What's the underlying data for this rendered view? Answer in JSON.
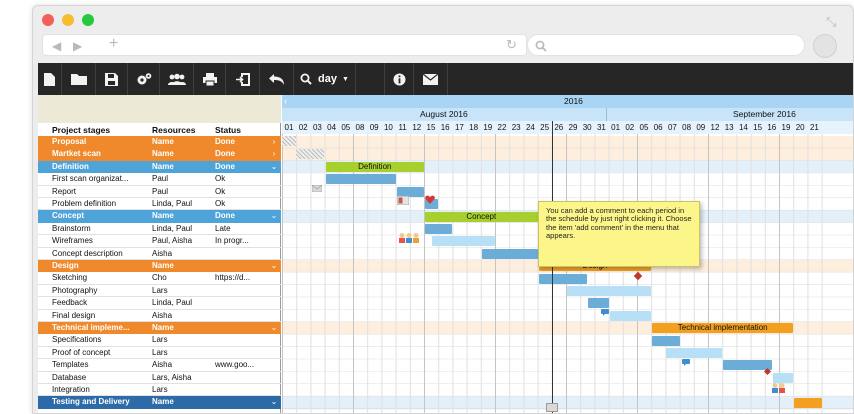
{
  "toolbar": {
    "zoom_label": "day"
  },
  "timeline": {
    "year": "2016",
    "months": [
      "August 2016",
      "September 2016"
    ],
    "days": [
      "01",
      "02",
      "03",
      "04",
      "05",
      "08",
      "09",
      "10",
      "11",
      "12",
      "15",
      "16",
      "17",
      "18",
      "19",
      "22",
      "23",
      "24",
      "25",
      "26",
      "29",
      "30",
      "31",
      "01",
      "02",
      "05",
      "06",
      "07",
      "08",
      "09",
      "12",
      "13",
      "14",
      "15",
      "16",
      "19",
      "20",
      "21"
    ]
  },
  "columns": {
    "stage": "Project stages",
    "resources": "Resources",
    "status": "Status"
  },
  "rows": [
    {
      "stage": "Proposal",
      "resources": "Name",
      "status": "Done",
      "group": true,
      "color": "#f0892b",
      "chevron": "›"
    },
    {
      "stage": "Martket scan",
      "resources": "Name",
      "status": "Done",
      "group": true,
      "color": "#f0892b",
      "chevron": "›"
    },
    {
      "stage": "Definition",
      "resources": "Name",
      "status": "Done",
      "group": true,
      "color": "#4ea3d8",
      "chevron": "⌄"
    },
    {
      "stage": "First scan organizat...",
      "resources": "Paul",
      "status": "Ok"
    },
    {
      "stage": "Report",
      "resources": "Paul",
      "status": "Ok"
    },
    {
      "stage": "Problem definition",
      "resources": "Linda, Paul",
      "status": "Ok"
    },
    {
      "stage": "Concept",
      "resources": "Name",
      "status": "Done",
      "group": true,
      "color": "#4ea3d8",
      "chevron": "⌄"
    },
    {
      "stage": "Brainstorm",
      "resources": "Linda, Paul",
      "status": "Late"
    },
    {
      "stage": "Wireframes",
      "resources": "Paul, Aisha",
      "status": "In progr..."
    },
    {
      "stage": "Concept description",
      "resources": "Aisha",
      "status": ""
    },
    {
      "stage": "Design",
      "resources": "Name",
      "status": "",
      "group": true,
      "color": "#f0892b",
      "chevron": "⌄"
    },
    {
      "stage": "Sketching",
      "resources": "Cho",
      "status": "https://d..."
    },
    {
      "stage": "Photography",
      "resources": "Lars",
      "status": ""
    },
    {
      "stage": "Feedback",
      "resources": "Linda, Paul",
      "status": ""
    },
    {
      "stage": "Final design",
      "resources": "Aisha",
      "status": ""
    },
    {
      "stage": "Technical impleme...",
      "resources": "Name",
      "status": "",
      "group": true,
      "color": "#f0892b",
      "chevron": "⌄"
    },
    {
      "stage": "Specifications",
      "resources": "Lars",
      "status": ""
    },
    {
      "stage": "Proof of concept",
      "resources": "Lars",
      "status": ""
    },
    {
      "stage": "Templates",
      "resources": "Aisha",
      "status": "www.goo..."
    },
    {
      "stage": "Database",
      "resources": "Lars, Aisha",
      "status": ""
    },
    {
      "stage": "Integration",
      "resources": "Lars",
      "status": ""
    },
    {
      "stage": "Testing and Delivery",
      "resources": "Name",
      "status": "",
      "group": true,
      "color": "#2d6aa8",
      "chevron": "⌄"
    }
  ],
  "bars": [
    {
      "row": 2,
      "start": 3,
      "end": 10,
      "color": "#a7cf2e",
      "label": "Definition"
    },
    {
      "row": 3,
      "start": 3,
      "end": 8,
      "color": "#6cadd8",
      "label": ""
    },
    {
      "row": 4,
      "start": 8,
      "end": 10,
      "color": "#6cadd8",
      "label": ""
    },
    {
      "row": 5,
      "start": 10,
      "end": 11,
      "color": "#6cadd8",
      "label": ""
    },
    {
      "row": 6,
      "start": 10,
      "end": 18,
      "color": "#a7cf2e",
      "label": "Concept"
    },
    {
      "row": 7,
      "start": 10,
      "end": 12,
      "color": "#6cadd8",
      "label": ""
    },
    {
      "row": 8,
      "start": 10.5,
      "end": 15,
      "color": "#b7e0f7",
      "label": ""
    },
    {
      "row": 9,
      "start": 14,
      "end": 18,
      "color": "#6cadd8",
      "label": ""
    },
    {
      "row": 10,
      "start": 18,
      "end": 26,
      "color": "#f3a021",
      "label": "Design"
    },
    {
      "row": 11,
      "start": 18,
      "end": 21.5,
      "color": "#6cadd8",
      "label": ""
    },
    {
      "row": 12,
      "start": 20,
      "end": 26,
      "color": "#b7e0f7",
      "label": ""
    },
    {
      "row": 13,
      "start": 21.5,
      "end": 23,
      "color": "#6cadd8",
      "label": ""
    },
    {
      "row": 14,
      "start": 23,
      "end": 26,
      "color": "#b7e0f7",
      "label": ""
    },
    {
      "row": 15,
      "start": 26,
      "end": 36,
      "color": "#f3a021",
      "label": "Technical implementation"
    },
    {
      "row": 16,
      "start": 26,
      "end": 28,
      "color": "#6cadd8",
      "label": ""
    },
    {
      "row": 17,
      "start": 27,
      "end": 31,
      "color": "#b7e0f7",
      "label": ""
    },
    {
      "row": 18,
      "start": 31,
      "end": 34.5,
      "color": "#6cadd8",
      "label": ""
    },
    {
      "row": 19,
      "start": 34.5,
      "end": 36,
      "color": "#b7e0f7",
      "label": ""
    },
    {
      "row": 21,
      "start": 36,
      "end": 38,
      "color": "#f3a021",
      "label": ""
    }
  ],
  "comment": {
    "text": "You can add a comment to each period in the schedule by just right clicking it. Choose the item 'add comment' in the menu that appears."
  },
  "colors": {
    "orange_group": "#f0892b",
    "blue_group": "#4ea3d8",
    "dark_blue_group": "#2d6aa8",
    "task_bar": "#6cadd8",
    "planned_bar": "#b7e0f7",
    "phase_green": "#a7cf2e",
    "phase_orange": "#f3a021",
    "toolbar_bg": "#262626"
  }
}
